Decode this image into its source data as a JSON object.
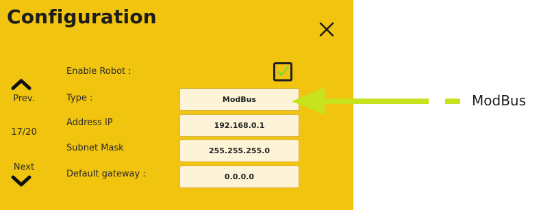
{
  "dialog": {
    "title": "Configuration",
    "close_icon": "close-icon",
    "background_color": "#f1c40f"
  },
  "navigation": {
    "prev_label": "Prev.",
    "page_indicator": "17/20",
    "next_label": "Next",
    "prev_icon": "chevron-up-icon",
    "next_icon": "chevron-down-icon"
  },
  "form": {
    "enable_robot": {
      "label": "Enable Robot :",
      "checked": true,
      "check_color": "#7fd43a"
    },
    "type": {
      "label": "Type :",
      "value": "ModBus"
    },
    "address_ip": {
      "label": "Address IP",
      "value": "192.168.0.1"
    },
    "subnet_mask": {
      "label": "Subnet Mask",
      "value": "255.255.255.0"
    },
    "default_gateway": {
      "label": "Default gateway :",
      "value": "0.0.0.0"
    }
  },
  "annotation": {
    "callout_text": "ModBus",
    "arrow_color": "#c6e31e"
  }
}
